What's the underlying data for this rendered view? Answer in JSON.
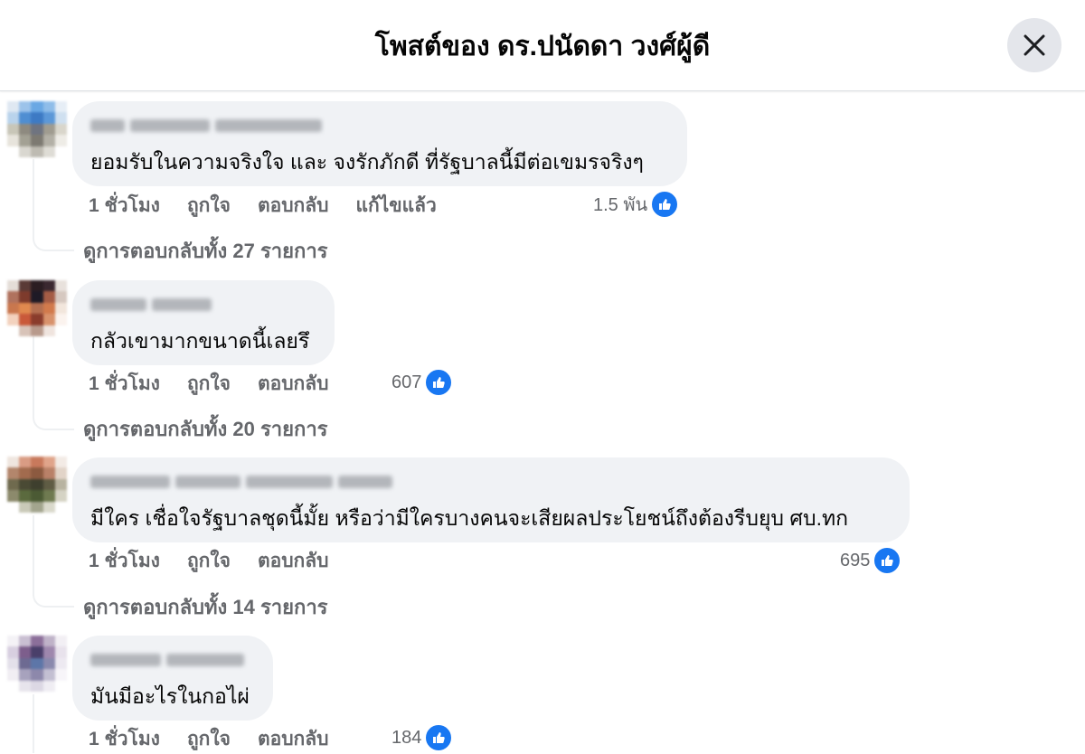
{
  "header": {
    "title": "โพสต์ของ ดร.ปนัดดา วงศ์ผู้ดี",
    "close_icon": "close-icon"
  },
  "comments": [
    {
      "text": "ยอมรับในความจริงใจ และ จงรักภักดี ที่รัฐบาลนี้มีต่อเขมรจริงๆ",
      "time": "1 ชั่วโมง",
      "like": "ถูกใจ",
      "reply": "ตอบกลับ",
      "edited": "แก้ไขแล้ว",
      "reaction_count": "1.5 พัน",
      "view_replies": "ดูการตอบกลับทั้ง 27 รายการ"
    },
    {
      "text": "กลัวเขามากขนาดนี้เลยรึ",
      "time": "1 ชั่วโมง",
      "like": "ถูกใจ",
      "reply": "ตอบกลับ",
      "reaction_count": "607",
      "view_replies": "ดูการตอบกลับทั้ง 20 รายการ"
    },
    {
      "text": "มีใคร เชื่อใจรัฐบาลชุดนี้มั้ย หรือว่ามีใครบางคนจะเสียผลประโยชน์ถึงต้องรีบยุบ ศบ.ทก",
      "time": "1 ชั่วโมง",
      "like": "ถูกใจ",
      "reply": "ตอบกลับ",
      "reaction_count": "695",
      "view_replies": "ดูการตอบกลับทั้ง 14 รายการ"
    },
    {
      "text": "มันมีอะไรในกอไผ่",
      "time": "1 ชั่วโมง",
      "like": "ถูกใจ",
      "reply": "ตอบกลับ",
      "reaction_count": "184"
    }
  ],
  "colors": {
    "bubble": "#f0f2f5",
    "secondary_text": "#65676b",
    "like_blue": "#1877f2",
    "divider": "#dadde1"
  }
}
